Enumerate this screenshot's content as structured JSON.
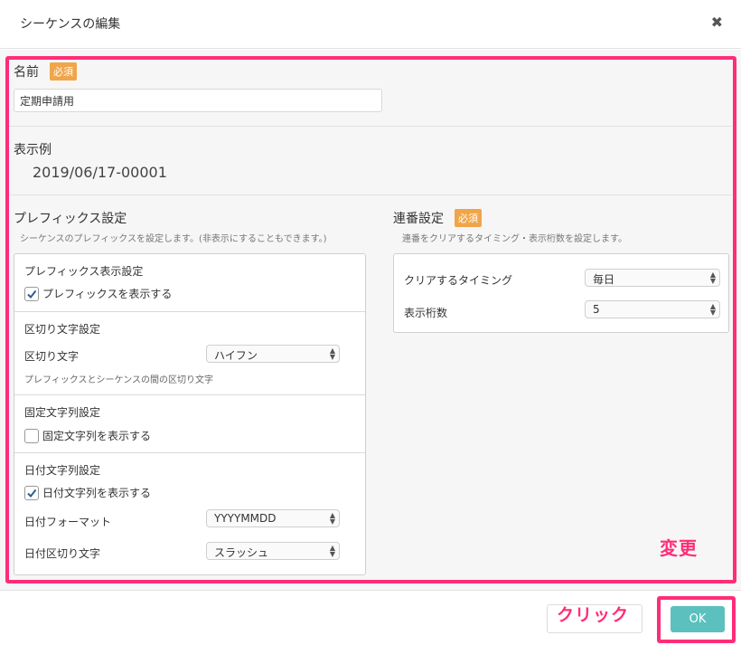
{
  "dialog": {
    "title": "シーケンスの編集",
    "close_icon": "close-icon"
  },
  "name": {
    "label": "名前",
    "required_badge": "必須",
    "value": "定期申請用"
  },
  "example": {
    "label": "表示例",
    "value": "2019/06/17-00001"
  },
  "prefix": {
    "title": "プレフィックス設定",
    "description": "シーケンスのプレフィックスを設定します。(非表示にすることもできます。)",
    "display": {
      "title": "プレフィックス表示設定",
      "checkbox_label": "プレフィックスを表示する",
      "checked": true
    },
    "separator": {
      "title": "区切り文字設定",
      "field_label": "区切り文字",
      "selected": "ハイフン",
      "hint": "プレフィックスとシーケンスの間の区切り文字"
    },
    "fixed_string": {
      "title": "固定文字列設定",
      "checkbox_label": "固定文字列を表示する",
      "checked": false
    },
    "date_string": {
      "title": "日付文字列設定",
      "checkbox_label": "日付文字列を表示する",
      "checked": true,
      "format_label": "日付フォーマット",
      "format_selected": "YYYYMMDD",
      "date_sep_label": "日付区切り文字",
      "date_sep_selected": "スラッシュ"
    }
  },
  "serial": {
    "title": "連番設定",
    "required_badge": "必須",
    "description": "連番をクリアするタイミング・表示桁数を設定します。",
    "clear_timing_label": "クリアするタイミング",
    "clear_timing_selected": "毎日",
    "digits_label": "表示桁数",
    "digits_selected": "5"
  },
  "annotations": {
    "change": "変更",
    "click": "クリック",
    "highlight_color": "#ff2d77"
  },
  "footer": {
    "ok_label": "OK",
    "ok_color": "#5bc0be"
  }
}
